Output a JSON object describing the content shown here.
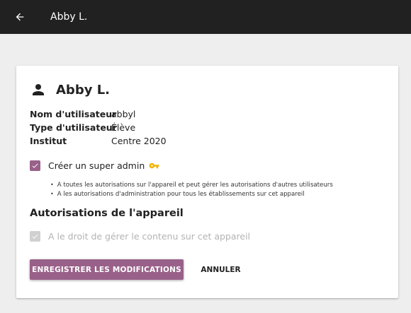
{
  "appbar": {
    "title": "Abby L.",
    "back_icon": "arrow-back-icon"
  },
  "user": {
    "name": "Abby L.",
    "icon": "person-icon",
    "details": [
      {
        "label": "Nom d'utilisateur",
        "value": "abbyl"
      },
      {
        "label": "Type d'utilisateur",
        "value": "Élève"
      },
      {
        "label": "Institut",
        "value": "Centre 2020"
      }
    ]
  },
  "super_admin": {
    "label": "Créer un super admin",
    "checked": true,
    "icon": "key-icon",
    "bullets": [
      "A toutes les autorisations sur l'appareil et peut gérer les autorisations d'autres utilisateurs",
      "A les autorisations d'administration pour tous les établissements sur cet appareil"
    ]
  },
  "device_permissions": {
    "title": "Autorisations de l'appareil",
    "manage_content_label": "A le droit de gérer le contenu sur cet appareil",
    "manage_content_checked": true,
    "manage_content_disabled": true
  },
  "actions": {
    "save_label": "ENREGISTRER LES MODIFICATIONS",
    "cancel_label": "ANNULER"
  },
  "colors": {
    "appbar": "#212121",
    "accent": "#996189",
    "key": "#f0b400",
    "background": "#eeeeee"
  }
}
